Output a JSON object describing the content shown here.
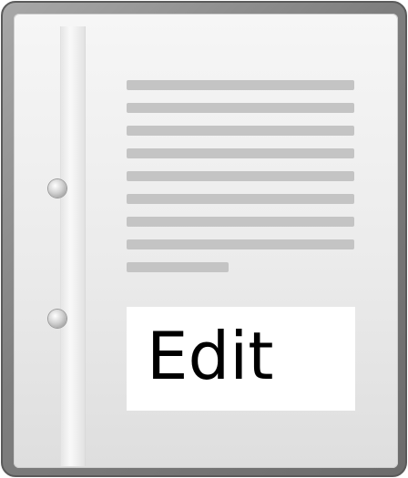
{
  "icon": {
    "name": "document-edit-icon",
    "label": "Edit",
    "text_line_count": 9,
    "colors": {
      "frame": "#7e7e7e",
      "sheet": "#ebebeb",
      "text_lines": "#c4c4c4",
      "label_background": "#ffffff",
      "label_text": "#000000"
    }
  }
}
